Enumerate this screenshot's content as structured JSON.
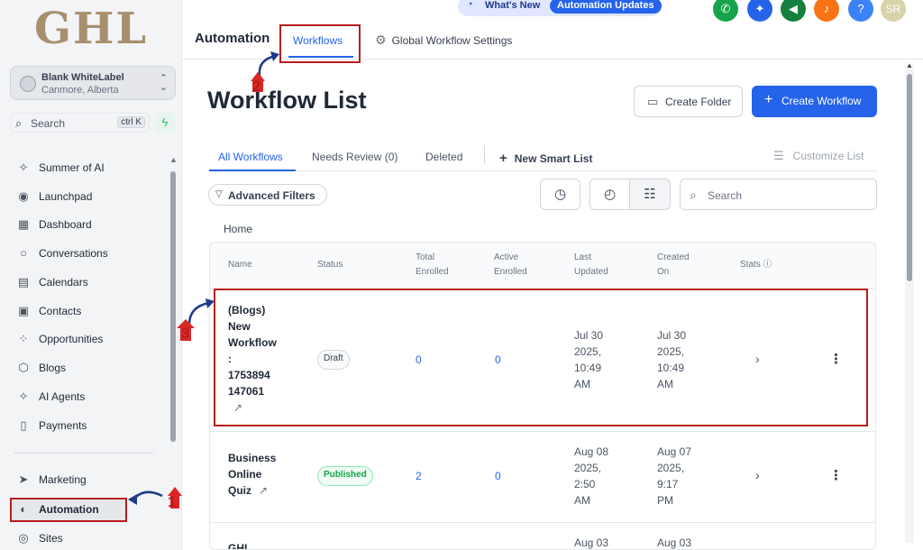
{
  "brand": {
    "logo": "GHL"
  },
  "account": {
    "name": "Blank WhiteLabel",
    "location": "Canmore, Alberta"
  },
  "sidebar_search": {
    "label": "Search",
    "shortcut": "ctrl K"
  },
  "sidebar": {
    "items": [
      {
        "label": "Summer of AI",
        "icon": "sparkle-icon"
      },
      {
        "label": "Launchpad",
        "icon": "rocket-icon"
      },
      {
        "label": "Dashboard",
        "icon": "dashboard-icon"
      },
      {
        "label": "Conversations",
        "icon": "chat-icon"
      },
      {
        "label": "Calendars",
        "icon": "calendar-icon"
      },
      {
        "label": "Contacts",
        "icon": "contacts-icon"
      },
      {
        "label": "Opportunities",
        "icon": "opportunities-icon"
      },
      {
        "label": "Blogs",
        "icon": "blogs-icon"
      },
      {
        "label": "AI Agents",
        "icon": "ai-agents-icon"
      },
      {
        "label": "Payments",
        "icon": "payments-icon"
      },
      {
        "label": "Marketing",
        "icon": "send-icon"
      },
      {
        "label": "Automation",
        "icon": "automation-icon"
      },
      {
        "label": "Sites",
        "icon": "globe-icon"
      }
    ]
  },
  "topbar": {
    "section": "Automation",
    "tab_workflows": "Workflows",
    "tab_settings": "Global Workflow Settings",
    "whats_new": "What's New",
    "automation_updates": "Automation Updates",
    "avatar_initials": "SR"
  },
  "page": {
    "title": "Workflow List",
    "create_folder": "Create Folder",
    "create_workflow": "Create Workflow"
  },
  "filter_tabs": {
    "all": "All Workflows",
    "needs_review": "Needs Review (0)",
    "deleted": "Deleted",
    "new_smart_list": "New Smart List",
    "customize": "Customize List"
  },
  "filters": {
    "advanced": "Advanced Filters",
    "search_placeholder": "Search"
  },
  "breadcrumb": "Home",
  "table": {
    "headers": {
      "name": "Name",
      "status": "Status",
      "total_1": "Total",
      "total_2": "Enrolled",
      "active_1": "Active",
      "active_2": "Enrolled",
      "updated_1": "Last",
      "updated_2": "Updated",
      "created_1": "Created",
      "created_2": "On",
      "stats": "Stats"
    },
    "rows": [
      {
        "name_lines": [
          "(Blogs)",
          "New",
          "Workflow",
          ":",
          "1753894",
          "147061"
        ],
        "status": "Draft",
        "total": "0",
        "active": "0",
        "updated_lines": [
          "Jul 30",
          "2025,",
          "10:49",
          "AM"
        ],
        "created_lines": [
          "Jul 30",
          "2025,",
          "10:49",
          "AM"
        ]
      },
      {
        "name_lines": [
          "Business",
          "Online",
          "Quiz"
        ],
        "status": "Published",
        "total": "2",
        "active": "0",
        "updated_lines": [
          "Aug 08",
          "2025,",
          "2:50",
          "AM"
        ],
        "created_lines": [
          "Aug 07",
          "2025,",
          "9:17",
          "PM"
        ]
      },
      {
        "name_lines": [
          "GHL"
        ],
        "updated_lines": [
          "Aug 03"
        ],
        "created_lines": [
          "Aug 03"
        ]
      }
    ]
  },
  "annotations": {
    "one": "1",
    "two": "2",
    "three": "3"
  },
  "colors": {
    "accent": "#2563eb",
    "highlight": "#b91c1c",
    "published": "#16a34a"
  }
}
